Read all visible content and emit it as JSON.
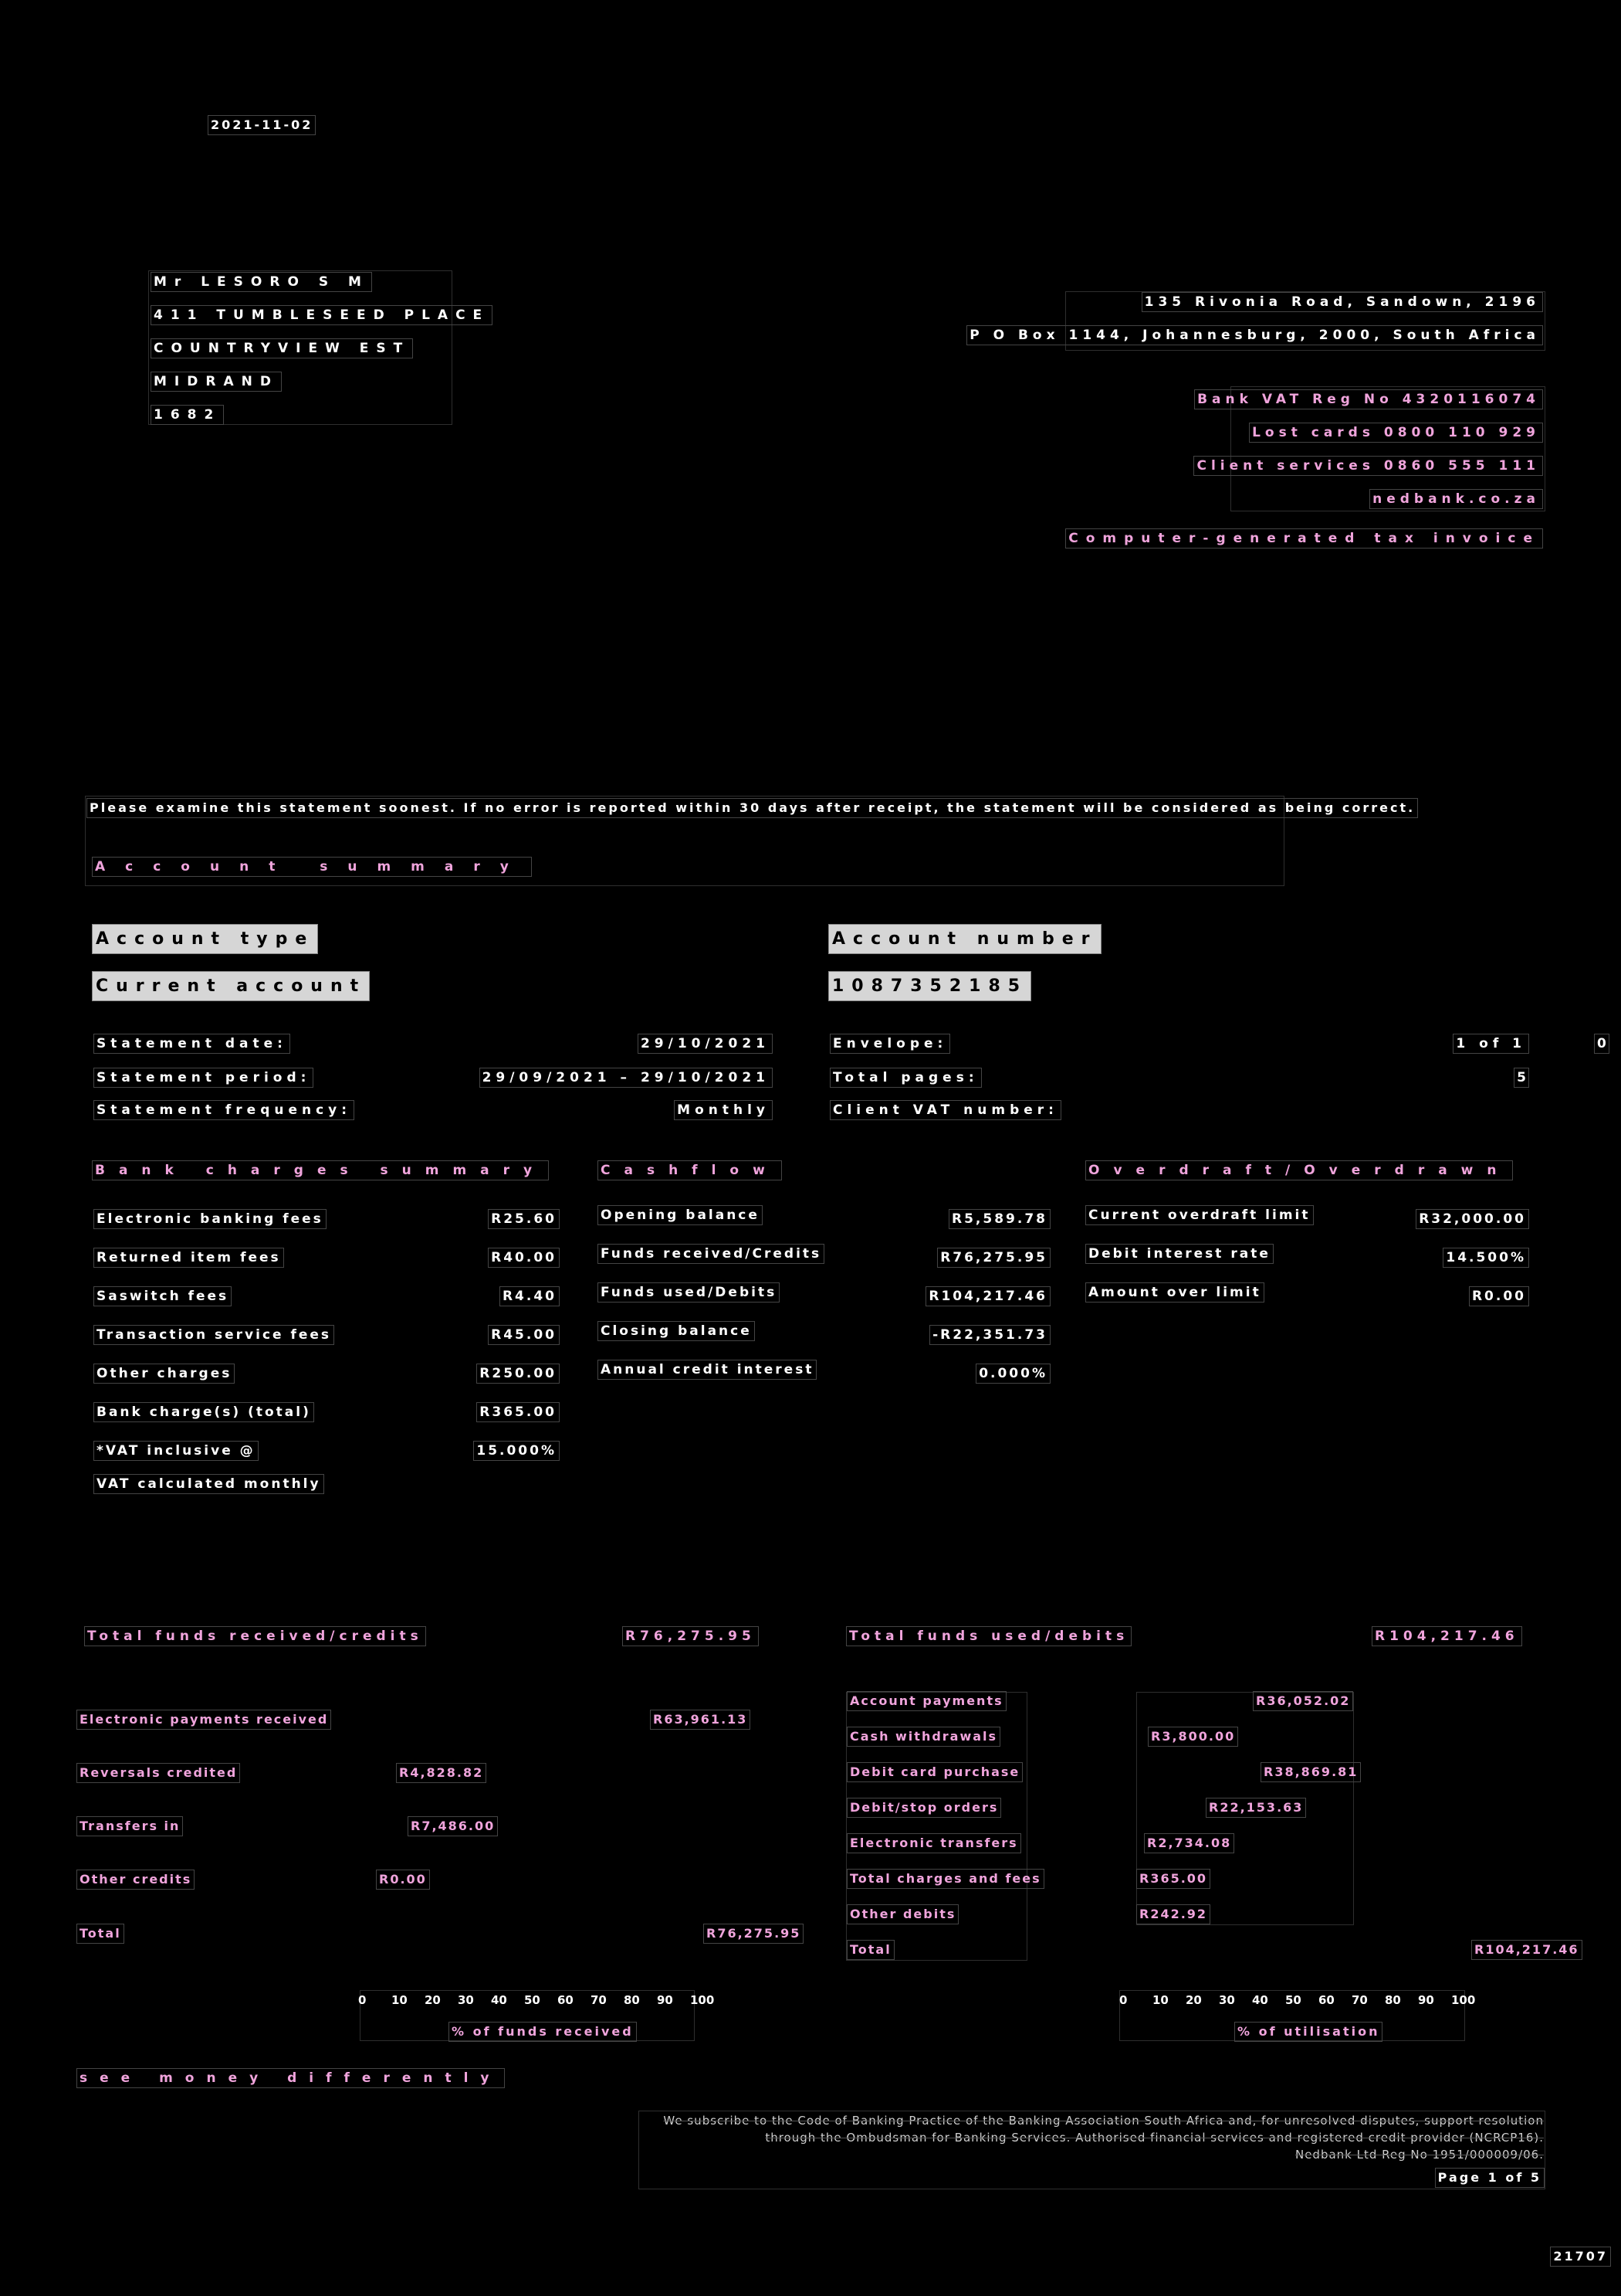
{
  "header": {
    "date": "2021-11-02"
  },
  "address": {
    "lines": [
      "Mr LESORO S M",
      "411 TUMBLESEED PLACE",
      "COUNTRYVIEW EST",
      "MIDRAND",
      "1682"
    ]
  },
  "bank": {
    "address_lines": [
      "135 Rivonia Road, Sandown, 2196",
      "P O Box 1144, Johannesburg, 2000, South Africa"
    ],
    "info_lines": [
      "Bank VAT Reg No 4320116074",
      "Lost cards 0800 110 929",
      "Client services 0860 555 111",
      "nedbank.co.za"
    ],
    "tax_invoice": "Computer-generated tax invoice"
  },
  "notice": "Please examine this statement soonest. If no error is reported within 30 days after receipt, the statement will be considered as being correct.",
  "account_summary_title": "Account summary",
  "account": {
    "type_label": "Account type",
    "type_value": "Current account",
    "number_label": "Account number",
    "number_value": "1087352185"
  },
  "statement": {
    "date_label": "Statement date:",
    "date_value": "29/10/2021",
    "period_label": "Statement period:",
    "period_value": "29/09/2021 – 29/10/2021",
    "frequency_label": "Statement frequency:",
    "frequency_value": "Monthly",
    "envelope_label": "Envelope:",
    "envelope_value": "1 of 1",
    "envelope_extra": "0",
    "pages_label": "Total pages:",
    "pages_value": "5",
    "client_vat_label": "Client VAT number:"
  },
  "bank_charges": {
    "title": "Bank charges summary",
    "rows": [
      {
        "label": "Electronic banking fees",
        "value": "R25.60"
      },
      {
        "label": "Returned item fees",
        "value": "R40.00"
      },
      {
        "label": "Saswitch fees",
        "value": "R4.40"
      },
      {
        "label": "Transaction service fees",
        "value": "R45.00"
      },
      {
        "label": "Other charges",
        "value": "R250.00"
      },
      {
        "label": "Bank charge(s) (total)",
        "value": "R365.00"
      },
      {
        "label": "*VAT inclusive @",
        "value": "15.000%"
      }
    ],
    "footnote": "VAT calculated monthly"
  },
  "cashflow": {
    "title": "Cashflow",
    "rows": [
      {
        "label": "Opening balance",
        "value": "R5,589.78"
      },
      {
        "label": "Funds received/Credits",
        "value": "R76,275.95"
      },
      {
        "label": "Funds used/Debits",
        "value": "R104,217.46"
      },
      {
        "label": "Closing balance",
        "value": "-R22,351.73"
      },
      {
        "label": "Annual credit interest",
        "value": "0.000%"
      }
    ]
  },
  "overdraft": {
    "title": "Overdraft/Overdrawn",
    "rows": [
      {
        "label": "Current overdraft limit",
        "value": "R32,000.00"
      },
      {
        "label": "Debit interest rate",
        "value": "14.500%"
      },
      {
        "label": "Amount over limit",
        "value": "R0.00"
      }
    ]
  },
  "credits": {
    "title": "Total funds received/credits",
    "total": "R76,275.95",
    "rows": [
      {
        "label": "Electronic payments received",
        "value": "R63,961.13"
      },
      {
        "label": "Reversals credited",
        "value": "R4,828.82"
      },
      {
        "label": "Transfers in",
        "value": "R7,486.00"
      },
      {
        "label": "Other credits",
        "value": "R0.00"
      }
    ],
    "total_label": "Total",
    "total_value": "R76,275.95",
    "axis_caption": "% of funds received"
  },
  "debits": {
    "title": "Total funds used/debits",
    "total": "R104,217.46",
    "rows": [
      {
        "label": "Account payments",
        "value": "R36,052.02"
      },
      {
        "label": "Cash withdrawals",
        "value": "R3,800.00"
      },
      {
        "label": "Debit card purchase",
        "value": "R38,869.81"
      },
      {
        "label": "Debit/stop orders",
        "value": "R22,153.63"
      },
      {
        "label": "Electronic transfers",
        "value": "R2,734.08"
      },
      {
        "label": "Total charges and fees",
        "value": "R365.00"
      },
      {
        "label": "Other debits",
        "value": "R242.92"
      }
    ],
    "total_label": "Total",
    "total_value": "R104,217.46",
    "axis_caption": "% of utilisation"
  },
  "axis_ticks": [
    "0",
    "10",
    "20",
    "30",
    "40",
    "50",
    "60",
    "70",
    "80",
    "90",
    "100"
  ],
  "slogan": "see money differently",
  "fineprint": [
    "We subscribe to the Code of Banking Practice of the Banking Association South Africa and, for unresolved disputes, support resolution",
    "through the Ombudsman for Banking Services. Authorised financial services and registered credit provider (NCRCP16).",
    "Nedbank Ltd Reg No 1951/000009/06."
  ],
  "page_label": "Page 1 of 5",
  "doc_code": "21707"
}
